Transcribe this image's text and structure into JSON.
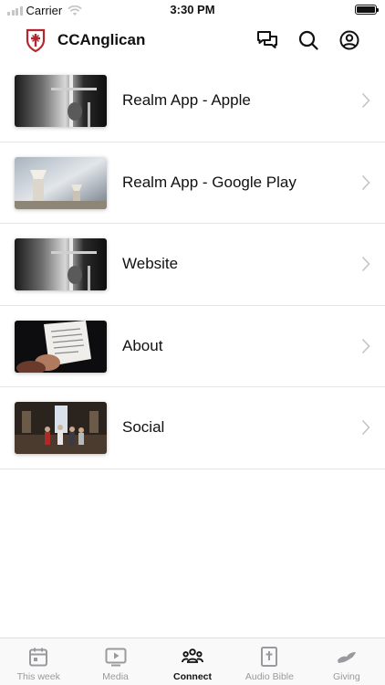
{
  "status_bar": {
    "carrier": "Carrier",
    "time": "3:30 PM",
    "battery_level": 1.0
  },
  "header": {
    "title": "CCAnglican",
    "logo_icon": "shield-cross-icon",
    "actions": [
      {
        "icon": "chat-bubbles-icon"
      },
      {
        "icon": "search-icon"
      },
      {
        "icon": "profile-icon"
      }
    ]
  },
  "list": {
    "items": [
      {
        "label": "Realm App - Apple",
        "thumbnail": "altar-cross-photo"
      },
      {
        "label": "Realm App - Google Play",
        "thumbnail": "altar-candlesticks-photo"
      },
      {
        "label": "Website",
        "thumbnail": "altar-cross-photo"
      },
      {
        "label": "About",
        "thumbnail": "hands-holding-paper-photo"
      },
      {
        "label": "Social",
        "thumbnail": "church-interior-gathering-photo"
      }
    ]
  },
  "tab_bar": {
    "active": "Connect",
    "tabs": [
      {
        "label": "This week",
        "icon": "calendar-icon"
      },
      {
        "label": "Media",
        "icon": "play-screen-icon"
      },
      {
        "label": "Connect",
        "icon": "people-group-icon"
      },
      {
        "label": "Audio Bible",
        "icon": "bible-icon"
      },
      {
        "label": "Giving",
        "icon": "giving-hand-icon"
      }
    ]
  },
  "colors": {
    "accent": "#111111",
    "inactive": "#9a9a9e",
    "logo_red": "#b3262e",
    "divider": "#e6e6e8"
  }
}
